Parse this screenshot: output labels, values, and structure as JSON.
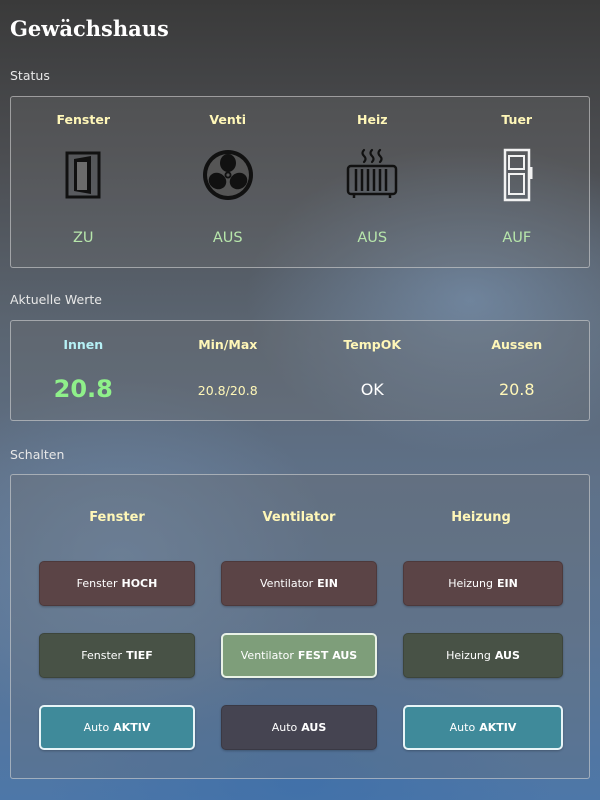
{
  "title": "Gewächshaus",
  "sections": {
    "status": "Status",
    "values": "Aktuelle Werte",
    "switches": "Schalten"
  },
  "status": [
    {
      "label": "Fenster",
      "icon": "window-icon",
      "state": "ZU"
    },
    {
      "label": "Venti",
      "icon": "fan-icon",
      "state": "AUS"
    },
    {
      "label": "Heiz",
      "icon": "heater-icon",
      "state": "AUS"
    },
    {
      "label": "Tuer",
      "icon": "door-icon",
      "state": "AUF"
    }
  ],
  "values": [
    {
      "label": "Innen",
      "value": "20.8"
    },
    {
      "label": "Min/Max",
      "value": "20.8/20.8"
    },
    {
      "label": "TempOK",
      "value": "OK"
    },
    {
      "label": "Aussen",
      "value": "20.8"
    }
  ],
  "switches": {
    "columns": [
      "Fenster",
      "Ventilator",
      "Heizung"
    ],
    "buttons": {
      "fenster_hoch": {
        "prefix": "Fenster",
        "state": "HOCH"
      },
      "fenster_tief": {
        "prefix": "Fenster",
        "state": "TIEF"
      },
      "fenster_auto": {
        "prefix": "Auto",
        "state": "AKTIV"
      },
      "venti_ein": {
        "prefix": "Ventilator",
        "state": "EIN"
      },
      "venti_fest_aus": {
        "prefix": "Ventilator",
        "state": "FEST AUS"
      },
      "venti_auto": {
        "prefix": "Auto",
        "state": "AUS"
      },
      "heiz_ein": {
        "prefix": "Heizung",
        "state": "EIN"
      },
      "heiz_aus": {
        "prefix": "Heizung",
        "state": "AUS"
      },
      "heiz_auto": {
        "prefix": "Auto",
        "state": "AKTIV"
      }
    }
  },
  "colors": {
    "heading": "#fff7b8",
    "state": "#b7e6ab",
    "inside_temp": "#8ff08a"
  }
}
